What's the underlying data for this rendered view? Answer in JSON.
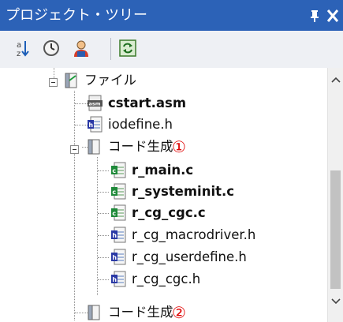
{
  "panel": {
    "title": "プロジェクト・ツリー",
    "pin_glyph": "ᵖ",
    "close_glyph": "✕"
  },
  "toolbar": {
    "buttons": [
      "sort-icon",
      "clock-icon",
      "user-icon",
      "refresh-icon"
    ]
  },
  "tree": {
    "folder_file": "ファイル",
    "cstart": "cstart.asm",
    "iodefine": "iodefine.h",
    "codegen1": "コード生成",
    "marker1": "①",
    "r_main": "r_main.c",
    "r_systeminit": "r_systeminit.c",
    "r_cg_cgc_c": "r_cg_cgc.c",
    "r_cg_macrodriver": "r_cg_macrodriver.h",
    "r_cg_userdefine": "r_cg_userdefine.h",
    "r_cg_cgc_h": "r_cg_cgc.h",
    "codegen2": "コード生成",
    "marker2": "②"
  },
  "colors": {
    "titlebar": "#2c62b7",
    "marker": "#e00000"
  }
}
